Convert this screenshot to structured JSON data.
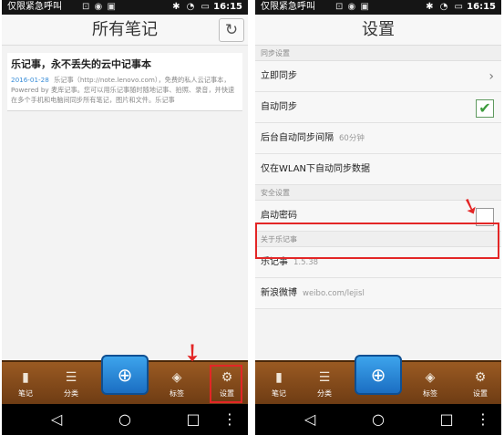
{
  "status_bar": {
    "carrier": "仅限紧急呼叫",
    "time": "16:15"
  },
  "left_screen": {
    "title": "所有笔记",
    "sync_icon": "sync-icon",
    "note": {
      "title": "乐记事，永不丢失的云中记事本",
      "date": "2016-01-28",
      "preview": "乐记事（http://note.lenovo.com），免费的私人云记事本，Powered by 麦库记事。您可以用乐记事随时随地记事、拍照、录音，并快速在多个手机和电脑间同步所有笔记，图片和文件。乐记事"
    },
    "tabs": {
      "notes": "笔记",
      "category": "分类",
      "tags": "标签",
      "settings": "设置"
    }
  },
  "right_screen": {
    "title": "设置",
    "sync_section": {
      "header": "同步设置",
      "sync_now": "立即同步",
      "auto_sync": "自动同步",
      "auto_sync_checked": true,
      "interval_label": "后台自动同步间隔",
      "interval_value": "60分钟",
      "wlan_only": "仅在WLAN下自动同步数据"
    },
    "security_section": {
      "header": "安全设置",
      "start_password": "启动密码",
      "start_password_checked": false
    },
    "about_section": {
      "header": "关于乐记事",
      "app_name": "乐记事",
      "version": "1.5.38",
      "weibo_label": "新浪微博",
      "weibo_value": "weibo.com/lejisl"
    },
    "tabs": {
      "notes": "笔记",
      "category": "分类",
      "tags": "标签",
      "settings": "设置"
    }
  },
  "colors": {
    "highlight": "#e32626",
    "tabbar": "#8a4d1c",
    "accent_blue": "#2a8ad8"
  }
}
